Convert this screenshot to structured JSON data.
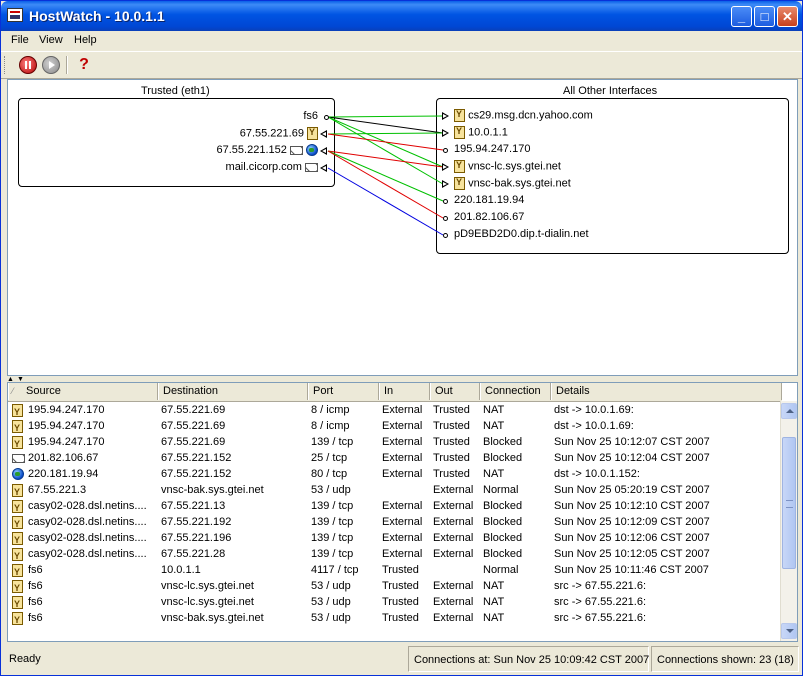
{
  "window": {
    "title": "HostWatch - 10.0.1.1"
  },
  "menu": {
    "file": "File",
    "view": "View",
    "help": "Help"
  },
  "toolbar": {
    "stop": "stop-icon",
    "start": "play-icon",
    "help": "?"
  },
  "diagram": {
    "left_label": "Trusted (eth1)",
    "right_label": "All Other Interfaces",
    "left_hosts": [
      {
        "name": "fs6",
        "icon": "none"
      },
      {
        "name": "67.55.221.69",
        "icon": "yellow-host-icon"
      },
      {
        "name": "67.55.221.152",
        "icon": "mail-globe-icon"
      },
      {
        "name": "mail.cicorp.com",
        "icon": "mail-icon"
      }
    ],
    "right_hosts": [
      {
        "name": "cs29.msg.dcn.yahoo.com",
        "icon": "yellow-host-icon"
      },
      {
        "name": "10.0.1.1",
        "icon": "yellow-host-icon"
      },
      {
        "name": "195.94.247.170",
        "icon": "none"
      },
      {
        "name": "vnsc-lc.sys.gtei.net",
        "icon": "yellow-host-icon"
      },
      {
        "name": "vnsc-bak.sys.gtei.net",
        "icon": "yellow-host-icon"
      },
      {
        "name": "220.181.19.94",
        "icon": "none"
      },
      {
        "name": "201.82.106.67",
        "icon": "none"
      },
      {
        "name": "pD9EBD2D0.dip.t-dialin.net",
        "icon": "none"
      }
    ],
    "connections": [
      {
        "from": 0,
        "to": 0,
        "color": "#00c000"
      },
      {
        "from": 0,
        "to": 1,
        "color": "#000000"
      },
      {
        "from": 0,
        "to": 3,
        "color": "#00c000"
      },
      {
        "from": 0,
        "to": 4,
        "color": "#00c000"
      },
      {
        "from": 1,
        "to": 1,
        "color": "#00c000"
      },
      {
        "from": 1,
        "to": 2,
        "color": "#e00000"
      },
      {
        "from": 2,
        "to": 3,
        "color": "#e00000"
      },
      {
        "from": 2,
        "to": 5,
        "color": "#00c000"
      },
      {
        "from": 2,
        "to": 6,
        "color": "#e00000"
      },
      {
        "from": 3,
        "to": 7,
        "color": "#0000e0"
      }
    ]
  },
  "table": {
    "columns": [
      "Source",
      "Destination",
      "Port",
      "In",
      "Out",
      "Connection",
      "Details"
    ],
    "rows": [
      {
        "icon": "yellow-host-icon",
        "source": "195.94.247.170",
        "destination": "67.55.221.69",
        "port": "8 / icmp",
        "in": "External",
        "out": "Trusted",
        "connection": "NAT",
        "details": "dst -> 10.0.1.69:"
      },
      {
        "icon": "yellow-host-icon",
        "source": "195.94.247.170",
        "destination": "67.55.221.69",
        "port": "8 / icmp",
        "in": "External",
        "out": "Trusted",
        "connection": "NAT",
        "details": "dst -> 10.0.1.69:"
      },
      {
        "icon": "yellow-host-icon",
        "source": "195.94.247.170",
        "destination": "67.55.221.69",
        "port": "139 / tcp",
        "in": "External",
        "out": "Trusted",
        "connection": "Blocked",
        "details": "Sun Nov 25 10:12:07 CST 2007"
      },
      {
        "icon": "mail-icon",
        "source": "201.82.106.67",
        "destination": "67.55.221.152",
        "port": "25 / tcp",
        "in": "External",
        "out": "Trusted",
        "connection": "Blocked",
        "details": "Sun Nov 25 10:12:04 CST 2007"
      },
      {
        "icon": "globe-icon",
        "source": "220.181.19.94",
        "destination": "67.55.221.152",
        "port": "80 / tcp",
        "in": "External",
        "out": "Trusted",
        "connection": "NAT",
        "details": "dst -> 10.0.1.152:"
      },
      {
        "icon": "yellow-host-icon",
        "source": "67.55.221.3",
        "destination": "vnsc-bak.sys.gtei.net",
        "port": "53 / udp",
        "in": "",
        "out": "External",
        "connection": "Normal",
        "details": "Sun Nov 25 05:20:19 CST 2007"
      },
      {
        "icon": "yellow-host-icon",
        "source": "casy02-028.dsl.netins....",
        "destination": "67.55.221.13",
        "port": "139 / tcp",
        "in": "External",
        "out": "External",
        "connection": "Blocked",
        "details": "Sun Nov 25 10:12:10 CST 2007"
      },
      {
        "icon": "yellow-host-icon",
        "source": "casy02-028.dsl.netins....",
        "destination": "67.55.221.192",
        "port": "139 / tcp",
        "in": "External",
        "out": "External",
        "connection": "Blocked",
        "details": "Sun Nov 25 10:12:09 CST 2007"
      },
      {
        "icon": "yellow-host-icon",
        "source": "casy02-028.dsl.netins....",
        "destination": "67.55.221.196",
        "port": "139 / tcp",
        "in": "External",
        "out": "External",
        "connection": "Blocked",
        "details": "Sun Nov 25 10:12:06 CST 2007"
      },
      {
        "icon": "yellow-host-icon",
        "source": "casy02-028.dsl.netins....",
        "destination": "67.55.221.28",
        "port": "139 / tcp",
        "in": "External",
        "out": "External",
        "connection": "Blocked",
        "details": "Sun Nov 25 10:12:05 CST 2007"
      },
      {
        "icon": "yellow-host-icon",
        "source": "fs6",
        "destination": "10.0.1.1",
        "port": "4117 / tcp",
        "in": "Trusted",
        "out": "",
        "connection": "Normal",
        "details": "Sun Nov 25 10:11:46 CST 2007"
      },
      {
        "icon": "yellow-host-icon",
        "source": "fs6",
        "destination": "vnsc-lc.sys.gtei.net",
        "port": "53 / udp",
        "in": "Trusted",
        "out": "External",
        "connection": "NAT",
        "details": "src -> 67.55.221.6:"
      },
      {
        "icon": "yellow-host-icon",
        "source": "fs6",
        "destination": "vnsc-lc.sys.gtei.net",
        "port": "53 / udp",
        "in": "Trusted",
        "out": "External",
        "connection": "NAT",
        "details": "src -> 67.55.221.6:"
      },
      {
        "icon": "yellow-host-icon",
        "source": "fs6",
        "destination": "vnsc-bak.sys.gtei.net",
        "port": "53 / udp",
        "in": "Trusted",
        "out": "External",
        "connection": "NAT",
        "details": "src -> 67.55.221.6:"
      }
    ]
  },
  "status": {
    "ready": "Ready",
    "connections_at": "Connections at: Sun Nov 25 10:09:42 CST 2007",
    "connections_shown": "Connections shown: 23 (18)"
  }
}
